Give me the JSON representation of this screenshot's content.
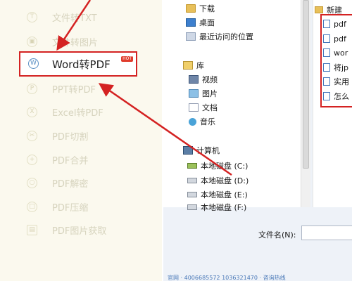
{
  "menu": {
    "items": [
      {
        "label": "文件转TXT",
        "icon": "txt-icon"
      },
      {
        "label": "文件转图片",
        "icon": "image-icon"
      },
      {
        "label": "Word转PDF",
        "icon": "word-icon",
        "badge": "HOT",
        "active": true
      },
      {
        "label": "PPT转PDF",
        "icon": "ppt-icon"
      },
      {
        "label": "Excel转PDF",
        "icon": "excel-icon"
      },
      {
        "label": "PDF切割",
        "icon": "pdf-split-icon"
      },
      {
        "label": "PDF合并",
        "icon": "pdf-merge-icon"
      },
      {
        "label": "PDF解密",
        "icon": "pdf-unlock-icon"
      },
      {
        "label": "PDF压缩",
        "icon": "pdf-compress-icon"
      },
      {
        "label": "PDF图片获取",
        "icon": "pdf-image-extract-icon"
      }
    ]
  },
  "dialog": {
    "nav": {
      "favorites": [
        {
          "label": "下载",
          "icon": "download-folder-icon"
        },
        {
          "label": "桌面",
          "icon": "desktop-icon"
        },
        {
          "label": "最近访问的位置",
          "icon": "recent-places-icon"
        }
      ],
      "libraries_label": "库",
      "libraries": [
        {
          "label": "视频",
          "icon": "video-library-icon"
        },
        {
          "label": "图片",
          "icon": "picture-library-icon"
        },
        {
          "label": "文档",
          "icon": "document-library-icon"
        },
        {
          "label": "音乐",
          "icon": "music-library-icon"
        }
      ],
      "computer_label": "计算机",
      "drives": [
        {
          "label": "本地磁盘 (C:)"
        },
        {
          "label": "本地磁盘 (D:)"
        },
        {
          "label": "本地磁盘 (E:)"
        },
        {
          "label": "本地磁盘 (F:)"
        }
      ]
    },
    "files": [
      {
        "label": "新建",
        "type": "folder"
      },
      {
        "label": "pdf",
        "type": "doc"
      },
      {
        "label": "pdf",
        "type": "doc"
      },
      {
        "label": "wor",
        "type": "doc"
      },
      {
        "label": "将jp",
        "type": "doc"
      },
      {
        "label": "实用",
        "type": "doc"
      },
      {
        "label": "怎么",
        "type": "doc"
      }
    ],
    "filename_label": "文件名(N):",
    "filename_value": ""
  },
  "status_text": "官网 · 4006685572 1036321470 · 咨询热线",
  "colors": {
    "highlight": "#d42222",
    "menu_bg": "#fbf9ee",
    "active_icon": "#5b90c4"
  }
}
